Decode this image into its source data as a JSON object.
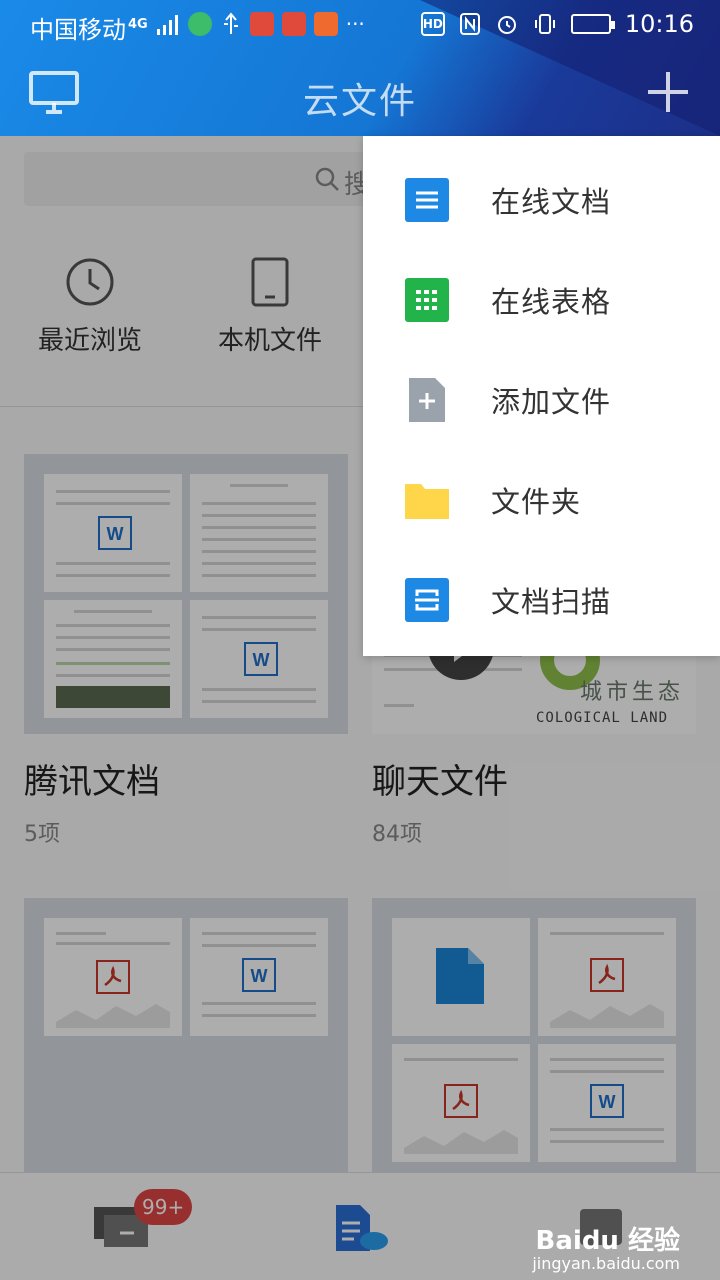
{
  "status_bar": {
    "carrier": "中国移动",
    "network": "4G",
    "time": "10:16",
    "hd": "HD"
  },
  "header": {
    "title": "云文件"
  },
  "search": {
    "placeholder_glyph": "搜"
  },
  "shortcuts": [
    {
      "label": "最近浏览",
      "icon": "clock-icon"
    },
    {
      "label": "本机文件",
      "icon": "phone-icon"
    }
  ],
  "cards": [
    {
      "title": "腾讯文档",
      "count": "5项"
    },
    {
      "title": "聊天文件",
      "count": "84项"
    },
    {
      "title": "",
      "count": ""
    },
    {
      "title": "",
      "count": ""
    }
  ],
  "card_text": {
    "city_cn": "城市生态",
    "city_en": "COLOGICAL LAND"
  },
  "menu": {
    "items": [
      {
        "label": "在线文档",
        "icon": "doc-lines-icon",
        "color": "#1e88e5"
      },
      {
        "label": "在线表格",
        "icon": "sheet-grid-icon",
        "color": "#22b34a"
      },
      {
        "label": "添加文件",
        "icon": "add-file-icon",
        "color": "#9aa2ab"
      },
      {
        "label": "文件夹",
        "icon": "folder-icon",
        "color": "#ffd54a"
      },
      {
        "label": "文档扫描",
        "icon": "scan-icon",
        "color": "#1e88e5"
      }
    ]
  },
  "bottom_nav": {
    "badge": "99+",
    "watermark": "Baidu 经验",
    "watermark_sub": "jingyan.baidu.com"
  },
  "colors": {
    "header_blue": "#1576d4",
    "accent_red": "#e04646"
  }
}
